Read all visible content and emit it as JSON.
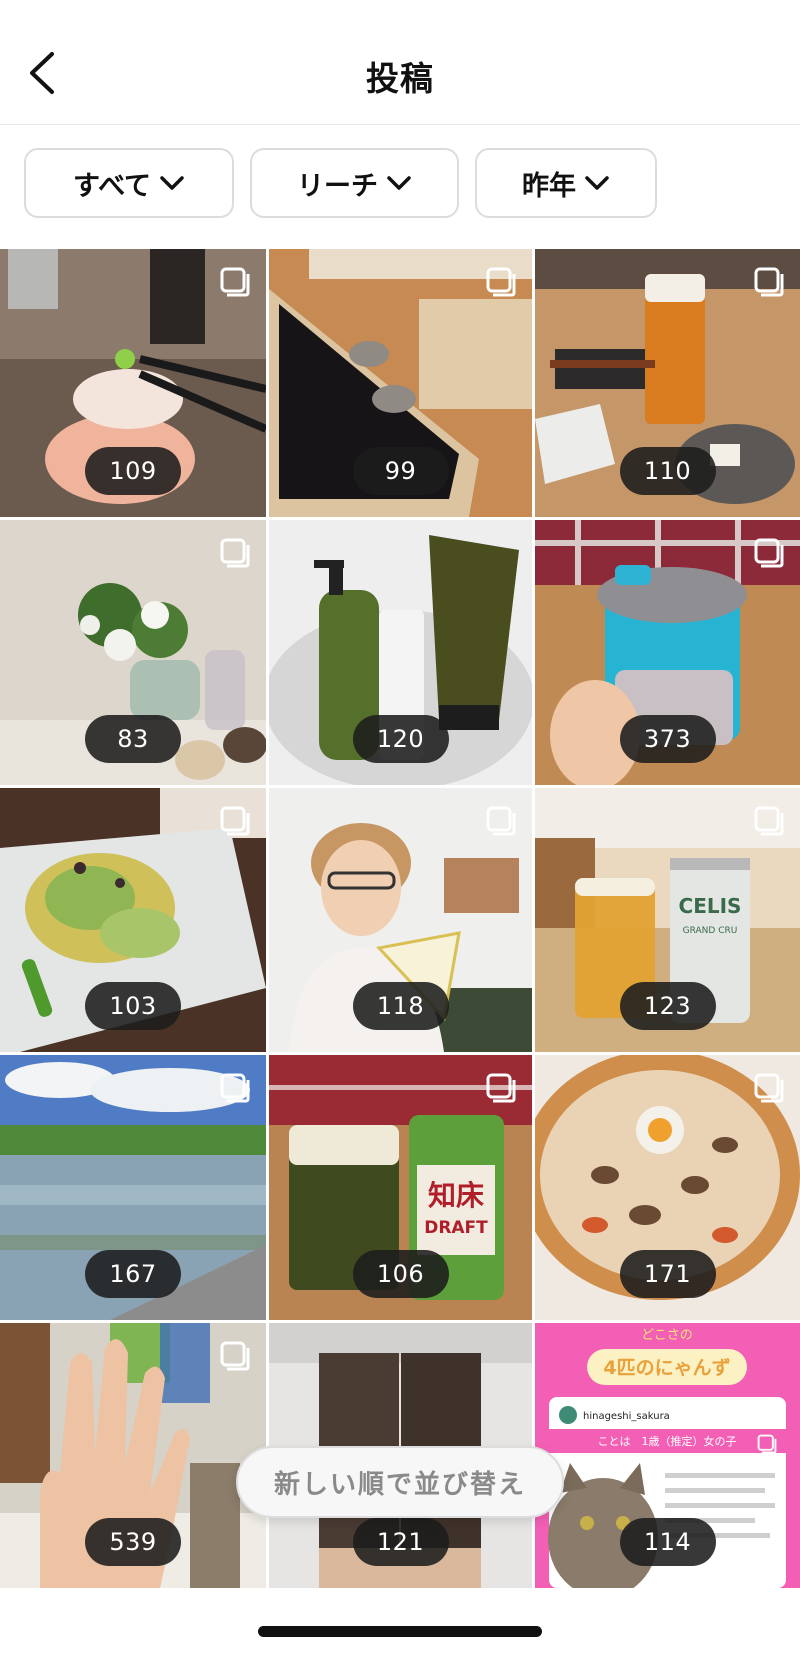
{
  "header": {
    "title": "投稿"
  },
  "filters": [
    {
      "label": "すべて"
    },
    {
      "label": "リーチ"
    },
    {
      "label": "昨年"
    }
  ],
  "posts": [
    {
      "count": "109",
      "scene": "sashimi-chopsticks",
      "carousel": true
    },
    {
      "count": "99",
      "scene": "frog-cufflinks-box",
      "carousel": true
    },
    {
      "count": "110",
      "scene": "beer-yakitori",
      "carousel": true
    },
    {
      "count": "83",
      "scene": "flower-vase",
      "carousel": true
    },
    {
      "count": "120",
      "scene": "bath-products",
      "carousel": false
    },
    {
      "count": "373",
      "scene": "blue-tumbler",
      "carousel": true
    },
    {
      "count": "103",
      "scene": "vegetable-salad",
      "carousel": true
    },
    {
      "count": "118",
      "scene": "selfie",
      "carousel": true
    },
    {
      "count": "123",
      "scene": "celis-beer",
      "carousel": true
    },
    {
      "count": "167",
      "scene": "rice-field",
      "carousel": true
    },
    {
      "count": "106",
      "scene": "shiretoko-draft-beer",
      "carousel": true
    },
    {
      "count": "171",
      "scene": "pizza",
      "carousel": true
    },
    {
      "count": "539",
      "scene": "hand-ring",
      "carousel": true
    },
    {
      "count": "121",
      "scene": "gift-boxes",
      "carousel": false
    },
    {
      "count": "114",
      "scene": "cat-post-card",
      "carousel": true
    }
  ],
  "cat_card": {
    "top_text": "どこさの",
    "banner": "4匹のにゃんず",
    "username": "hinageshi_sakura",
    "row": "ことは　1歳（推定）女の子"
  },
  "beer_can_1": {
    "brand": "CELIS",
    "sub": "GRAND CRU"
  },
  "beer_can_2": {
    "line1": "知床",
    "line2": "DRAFT"
  },
  "sort_button": {
    "label": "新しい順で並び替え"
  },
  "colors": {
    "pill_bg": "#1c1c1c",
    "accent_pink": "#f25fb4",
    "divider": "#e6e6e6"
  }
}
